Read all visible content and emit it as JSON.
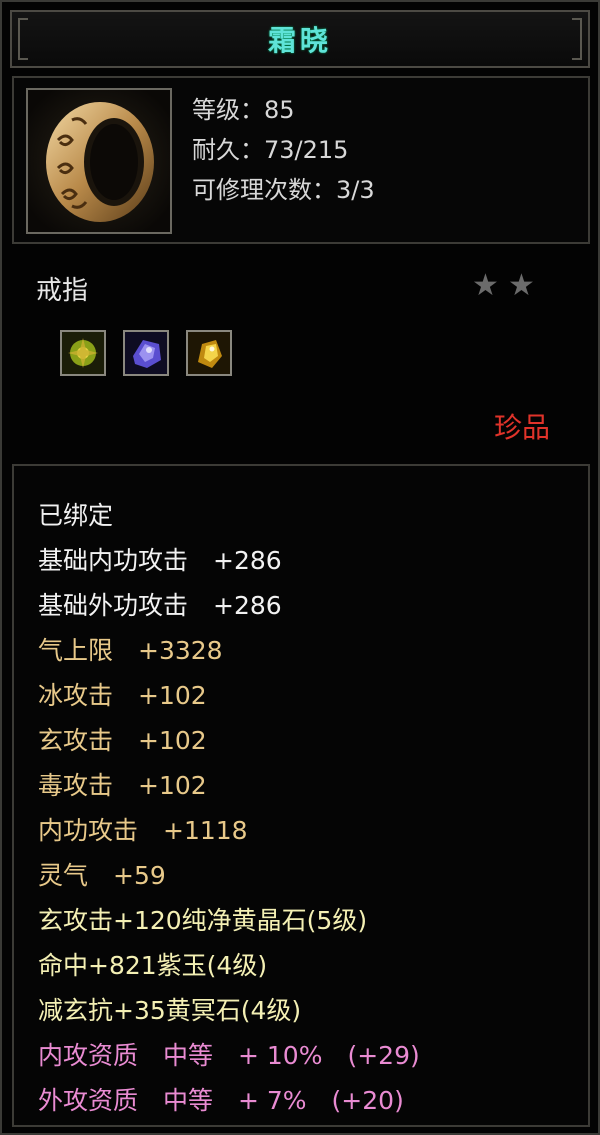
{
  "item": {
    "name": "霜晓",
    "level_line": "等级：85",
    "durability_line": "耐久：73/215",
    "repair_line": "可修理次数：3/3",
    "type": "戒指",
    "stars": 2,
    "rarity": "珍品",
    "icon": "ring-icon"
  },
  "gem_slots": [
    {
      "name": "yellow-green-gem-icon",
      "color": "#9ab020"
    },
    {
      "name": "purple-gem-icon",
      "color": "#6a5ad8"
    },
    {
      "name": "yellow-gem-icon",
      "color": "#e8b820"
    }
  ],
  "attributes": [
    {
      "text": "已绑定",
      "color": "white"
    },
    {
      "text": "基础内功攻击　+286",
      "color": "white"
    },
    {
      "text": "基础外功攻击　+286",
      "color": "white"
    },
    {
      "text": "气上限　+3328",
      "color": "gold"
    },
    {
      "text": "冰攻击　+102",
      "color": "gold"
    },
    {
      "text": "玄攻击　+102",
      "color": "gold"
    },
    {
      "text": "毒攻击　+102",
      "color": "gold"
    },
    {
      "text": "内功攻击　+1118",
      "color": "gold"
    },
    {
      "text": "灵气　+59",
      "color": "gold"
    },
    {
      "text": "玄攻击+120纯净黄晶石(5级)",
      "color": "pale"
    },
    {
      "text": "命中+821紫玉(4级)",
      "color": "pale"
    },
    {
      "text": "减玄抗+35黄冥石(4级)",
      "color": "pale"
    },
    {
      "text": "内攻资质　中等　+ 10%　(+29)",
      "color": "pink"
    },
    {
      "text": "外攻资质　中等　+ 7%　(+20)",
      "color": "pink"
    }
  ],
  "colors": {
    "title": "#5fe3d8",
    "rarity": "#e0332a",
    "white": "#f2f2f2",
    "gold": "#e8c98a",
    "pale": "#f4f0b4",
    "pink": "#e98bd2"
  }
}
